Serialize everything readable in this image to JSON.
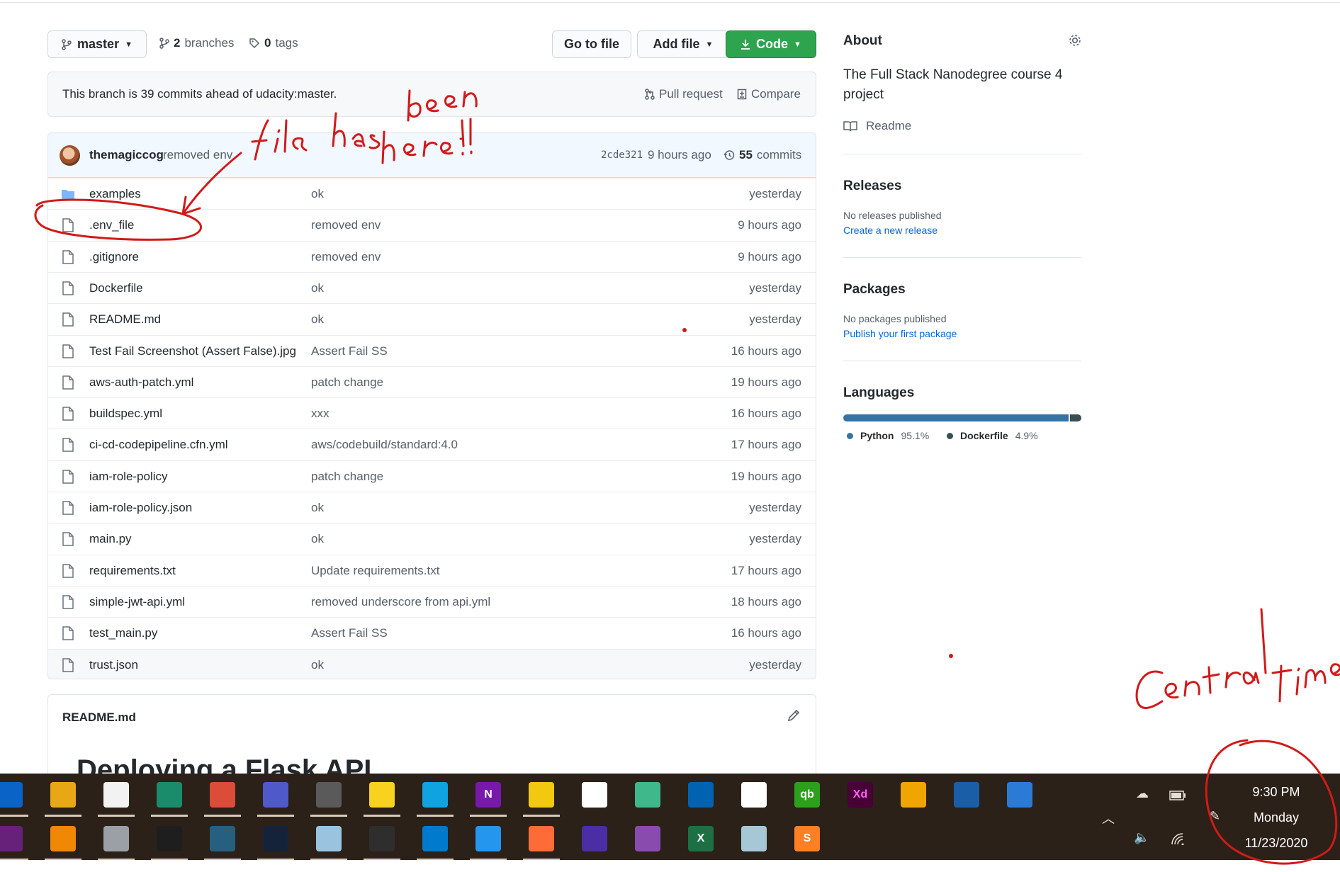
{
  "toolbar": {
    "branch": "master",
    "branches_count": "2",
    "branches_label": "branches",
    "tags_count": "0",
    "tags_label": "tags",
    "goto_file": "Go to file",
    "add_file": "Add file",
    "code": "Code"
  },
  "branch_info": {
    "message": "This branch is 39 commits ahead of udacity:master.",
    "pull_request": "Pull request",
    "compare": "Compare"
  },
  "latest_commit": {
    "author": "themagiccog",
    "message": "removed env",
    "sha": "2cde321",
    "time": "9 hours ago",
    "commits_count": "55",
    "commits_label": "commits"
  },
  "files": [
    {
      "name": "examples",
      "type": "folder",
      "message": "ok",
      "age": "yesterday"
    },
    {
      "name": ".env_file",
      "type": "file",
      "message": "removed env",
      "age": "9 hours ago"
    },
    {
      "name": ".gitignore",
      "type": "file",
      "message": "removed env",
      "age": "9 hours ago"
    },
    {
      "name": "Dockerfile",
      "type": "file",
      "message": "ok",
      "age": "yesterday"
    },
    {
      "name": "README.md",
      "type": "file",
      "message": "ok",
      "age": "yesterday"
    },
    {
      "name": "Test Fail Screenshot (Assert False).jpg",
      "type": "file",
      "message": "Assert Fail SS",
      "age": "16 hours ago"
    },
    {
      "name": "aws-auth-patch.yml",
      "type": "file",
      "message": "patch change",
      "age": "19 hours ago"
    },
    {
      "name": "buildspec.yml",
      "type": "file",
      "message": "xxx",
      "age": "16 hours ago"
    },
    {
      "name": "ci-cd-codepipeline.cfn.yml",
      "type": "file",
      "message": "aws/codebuild/standard:4.0",
      "age": "17 hours ago"
    },
    {
      "name": "iam-role-policy",
      "type": "file",
      "message": "patch change",
      "age": "19 hours ago"
    },
    {
      "name": "iam-role-policy.json",
      "type": "file",
      "message": "ok",
      "age": "yesterday"
    },
    {
      "name": "main.py",
      "type": "file",
      "message": "ok",
      "age": "yesterday"
    },
    {
      "name": "requirements.txt",
      "type": "file",
      "message": "Update requirements.txt",
      "age": "17 hours ago"
    },
    {
      "name": "simple-jwt-api.yml",
      "type": "file",
      "message": "removed underscore from api.yml",
      "age": "18 hours ago"
    },
    {
      "name": "test_main.py",
      "type": "file",
      "message": "Assert Fail SS",
      "age": "16 hours ago"
    },
    {
      "name": "trust.json",
      "type": "file",
      "message": "ok",
      "age": "yesterday"
    }
  ],
  "readme": {
    "filename": "README.md",
    "heading": "Deploying a Flask API"
  },
  "sidebar": {
    "about_title": "About",
    "description": "The Full Stack Nanodegree course 4 project",
    "readme_link": "Readme",
    "releases_title": "Releases",
    "releases_empty": "No releases published",
    "releases_link": "Create a new release",
    "packages_title": "Packages",
    "packages_empty": "No packages published",
    "packages_link": "Publish your first package",
    "languages_title": "Languages",
    "languages": [
      {
        "name": "Python",
        "percent": "95.1%",
        "share": 95.1,
        "color": "#3572a5"
      },
      {
        "name": "Dockerfile",
        "percent": "4.9%",
        "share": 4.9,
        "color": "#384d54"
      }
    ]
  },
  "annotations": {
    "file_note": "file has been here!!..",
    "time_note": "Central time"
  },
  "taskbar": {
    "row1_icons": [
      "outlook-icon",
      "file-explorer-icon",
      "microsoft-store-icon",
      "edge-beta-icon",
      "chrome-icon",
      "teams-icon",
      "snipping-tool-icon",
      "sticky-notes-icon",
      "authenticator-icon",
      "onenote-icon",
      "power-bi-icon",
      "tableau-icon",
      "atom-icon",
      "azure-data-studio-icon",
      "app-store-icon",
      "quickbooks-icon",
      "adobe-xd-icon",
      "transfer-icon",
      "virtualbox-icon",
      "remote-desktop-icon"
    ],
    "row2_icons": [
      "visual-studio-icon",
      "vlc-icon",
      "database-icon",
      "command-prompt-icon",
      "mysql-workbench-icon",
      "mysql-shell-icon",
      "mysql-notifier-icon",
      "terminal-preview-icon",
      "vscode-icon",
      "docker-icon",
      "postman-icon",
      "screen-recorder-icon",
      "github-desktop-icon",
      "excel-icon",
      "notepad-icon",
      "sublime-text-icon"
    ],
    "xd_label": "Xd",
    "sublime_label": "S",
    "excel_label": "X",
    "onenote_label": "N",
    "qb_label": "qb",
    "time": "9:30 PM",
    "day": "Monday",
    "date": "11/23/2020"
  }
}
